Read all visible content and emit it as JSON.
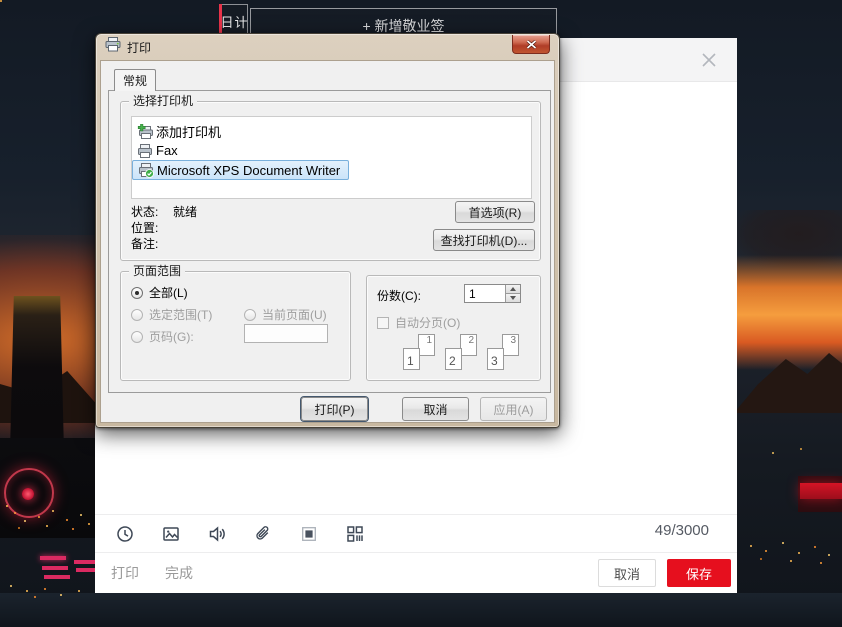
{
  "note_app": {
    "top_tab_label": "日计",
    "add_note_button": "+ 新增敬业签",
    "char_counter": "49/3000",
    "toolbar_icons": [
      "clock",
      "image",
      "speaker",
      "paperclip",
      "filled-square",
      "layout-grid"
    ],
    "footer": {
      "print_link": "打印",
      "done_link": "完成",
      "cancel_button": "取消",
      "save_button": "保存"
    }
  },
  "print_dialog": {
    "title": "打印",
    "tab_label": "常规",
    "printer_group": {
      "label": "选择打印机",
      "printers": [
        {
          "name": "添加打印机",
          "icon": "add-printer-icon"
        },
        {
          "name": "Fax",
          "icon": "printer-icon"
        },
        {
          "name": "Microsoft XPS Document Writer",
          "icon": "printer-ready-icon",
          "selected": true
        }
      ],
      "status_label": "状态:",
      "status_value": "就绪",
      "location_label": "位置:",
      "comment_label": "备注:",
      "preferences_button": "首选项(R)",
      "find_printer_button": "查找打印机(D)..."
    },
    "page_range_group": {
      "label": "页面范围",
      "all_option": "全部(L)",
      "selection_option": "选定范围(T)",
      "current_page_option": "当前页面(U)",
      "pages_option": "页码(G):"
    },
    "copies_group": {
      "copies_label": "份数(C):",
      "copies_value": "1",
      "collate_label": "自动分页(O)",
      "collate_pages": [
        "1",
        "2",
        "3"
      ]
    },
    "buttons": {
      "print": "打印(P)",
      "cancel": "取消",
      "apply": "应用(A)"
    }
  },
  "colors": {
    "save_button_red": "#e60f1e",
    "dialog_frame_tan": "#d2c4ae",
    "close_button_red": "#b03d27",
    "selection_blue": "#cbe4f9",
    "sunset_orange": "#f59d3e"
  }
}
